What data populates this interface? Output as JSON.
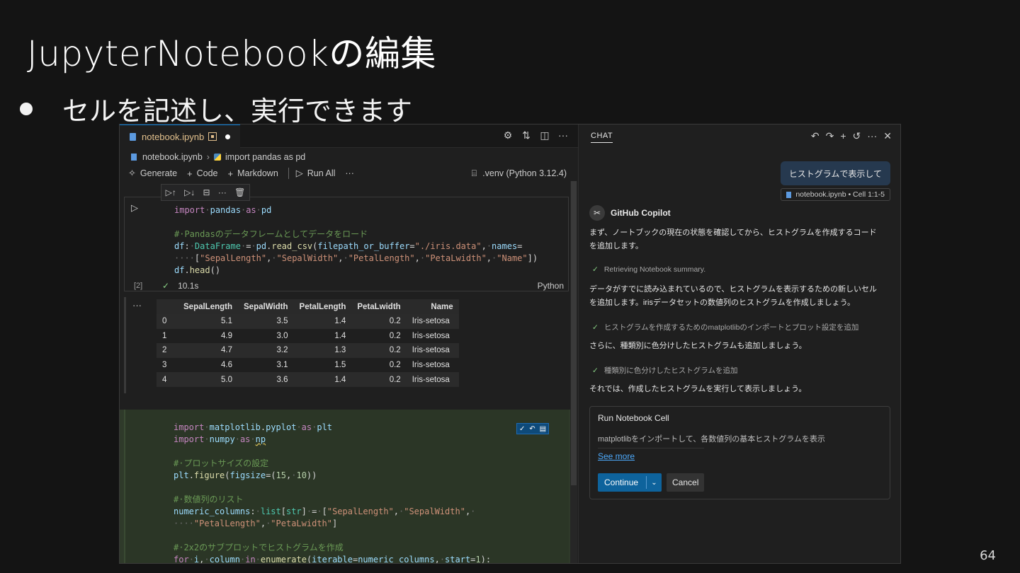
{
  "slide": {
    "title": "JupyterNotebookの編集",
    "bullet": "セルを記述し、実行できます",
    "page_number": "64"
  },
  "editor": {
    "tab": {
      "label": "notebook.ipynb"
    },
    "tab_actions": [
      "gear-icon",
      "compare-icon",
      "split-icon",
      "more-icon"
    ],
    "breadcrumb": {
      "file": "notebook.ipynb",
      "symbol": "import pandas as pd"
    },
    "toolbar": {
      "generate": "Generate",
      "code": "Code",
      "markdown": "Markdown",
      "run_all": "Run All",
      "more": "···"
    },
    "kernel": ".venv (Python 3.12.4)",
    "cell1": {
      "exec_count": "[2]",
      "duration": "10.1s",
      "language": "Python"
    },
    "output": {
      "ellipsis": "···",
      "columns": [
        "",
        "SepalLength",
        "SepalWidth",
        "PetalLength",
        "PetaLwidth",
        "Name"
      ],
      "rows": [
        [
          "0",
          "5.1",
          "3.5",
          "1.4",
          "0.2",
          "Iris-setosa"
        ],
        [
          "1",
          "4.9",
          "3.0",
          "1.4",
          "0.2",
          "Iris-setosa"
        ],
        [
          "2",
          "4.7",
          "3.2",
          "1.3",
          "0.2",
          "Iris-setosa"
        ],
        [
          "3",
          "4.6",
          "3.1",
          "1.5",
          "0.2",
          "Iris-setosa"
        ],
        [
          "4",
          "5.0",
          "3.6",
          "1.4",
          "0.2",
          "Iris-setosa"
        ]
      ]
    }
  },
  "chat": {
    "tab": "CHAT",
    "user_message": "ヒストグラムで表示して",
    "context_chip": "notebook.ipynb • Cell 1:1-5",
    "assistant_name": "GitHub Copilot",
    "msg1_line1": "まず、ノートブックの現在の状態を確認してから、ヒストグラムを作成するコード",
    "msg1_line2": "を追加します。",
    "step1": "Retrieving Notebook summary.",
    "msg2_line1": "データがすでに読み込まれているので、ヒストグラムを表示するための新しいセル",
    "msg2_line2": "を追加します。irisデータセットの数値列のヒストグラムを作成しましょう。",
    "step2": "ヒストグラムを作成するためのmatplotlibのインポートとプロット設定を追加",
    "msg3": "さらに、種類別に色分けしたヒストグラムも追加しましょう。",
    "step3": "種類別に色分けしたヒストグラムを追加",
    "msg4": "それでは、作成したヒストグラムを実行して表示しましょう。",
    "run_card": {
      "title": "Run Notebook Cell",
      "description": "matplotlibをインポートして、各数値列の基本ヒストグラムを表示",
      "see_more": "See more",
      "continue": "Continue",
      "cancel": "Cancel"
    }
  },
  "colors": {
    "accent": "#0078d4",
    "success": "#89d185",
    "link": "#4daafc",
    "button": "#0e639c"
  }
}
